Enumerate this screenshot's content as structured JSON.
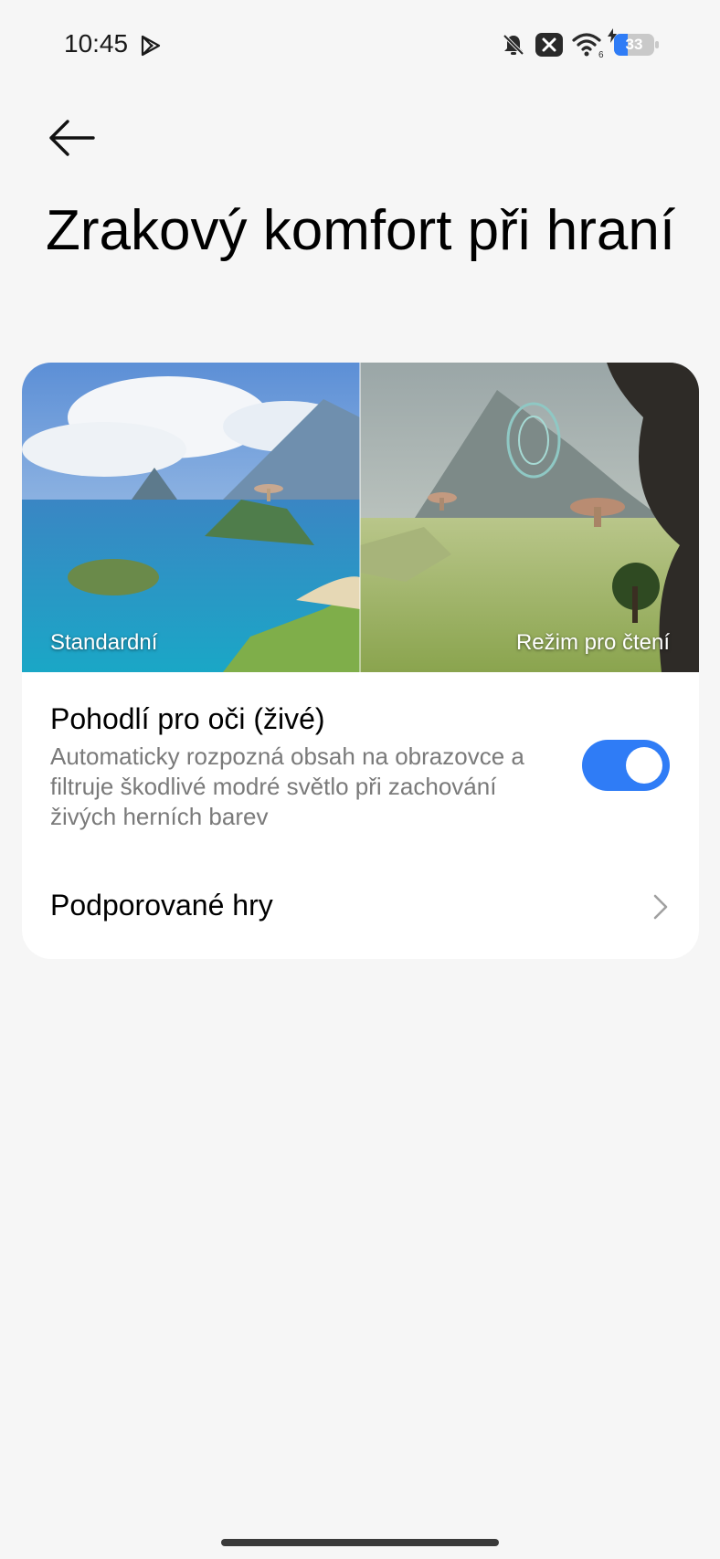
{
  "status_bar": {
    "time": "10:45",
    "icons": [
      "play-store-icon",
      "bell-off-icon",
      "close-box-icon",
      "wifi-6-icon",
      "battery-charging-icon"
    ],
    "wifi_badge": "6",
    "battery_level": "33",
    "battery_fraction": 0.33
  },
  "header": {
    "back_icon": "arrow-left-icon",
    "title": "Zrakový komfort při hraní"
  },
  "preview": {
    "left_label": "Standardní",
    "right_label": "Režim pro čtení"
  },
  "eye_comfort": {
    "title": "Pohodlí pro oči (živé)",
    "description": "Automaticky rozpozná obsah na obrazovce a filtruje škodlivé modré světlo při zachování živých herních barev",
    "enabled": true
  },
  "supported_games": {
    "label": "Podporované hry",
    "icon": "chevron-right-icon"
  },
  "colors": {
    "background": "#f6f6f6",
    "card": "#ffffff",
    "accent": "#2f7cf6",
    "secondary_text": "#7a7a7a"
  }
}
